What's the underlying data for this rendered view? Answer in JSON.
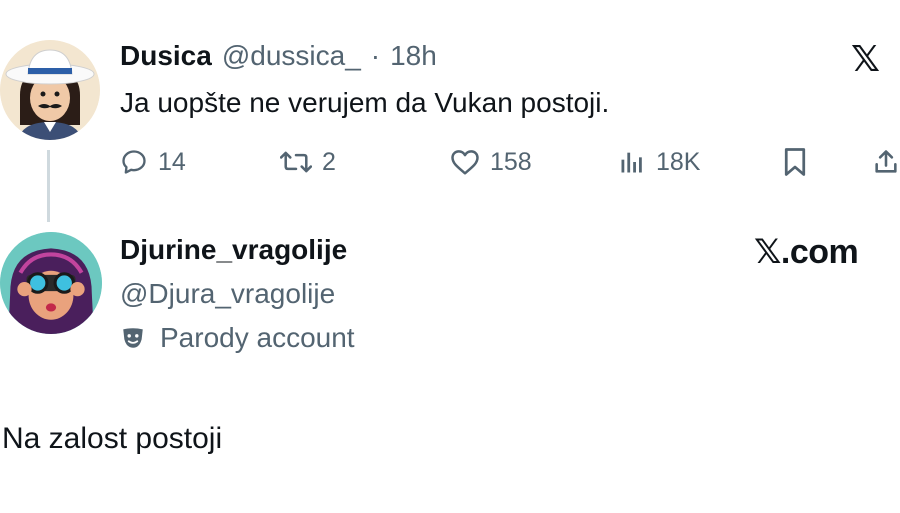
{
  "tweet": {
    "author_name": "Dusica",
    "author_handle": "@dussica_",
    "separator": "·",
    "time": "18h",
    "text": "Ja uopšte ne verujem da Vukan postoji.",
    "replies": "14",
    "reposts": "2",
    "likes": "158",
    "views": "18K"
  },
  "reply": {
    "author_name": "Djurine_vragolije",
    "author_handle": "@Djura_vragolije",
    "account_label": "Parody account",
    "text": "Na zalost postoji"
  },
  "branding": {
    "x_logo": "𝕏",
    "x_com_prefix": "𝕏",
    "x_com_suffix": ".com"
  },
  "colors": {
    "text": "#0f1419",
    "secondary": "#536471",
    "thread_line": "#cfd9de"
  }
}
